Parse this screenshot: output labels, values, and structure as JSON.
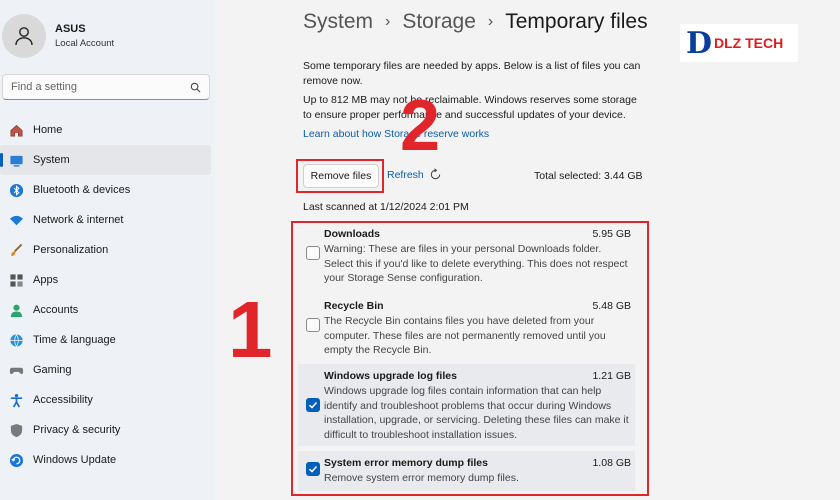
{
  "profile": {
    "name": "ASUS",
    "account": "Local Account"
  },
  "search": {
    "placeholder": "Find a setting"
  },
  "nav": [
    {
      "label": "Home",
      "icon": "home-icon"
    },
    {
      "label": "System",
      "icon": "monitor-icon",
      "active": true
    },
    {
      "label": "Bluetooth & devices",
      "icon": "bluetooth-icon"
    },
    {
      "label": "Network & internet",
      "icon": "wifi-icon"
    },
    {
      "label": "Personalization",
      "icon": "brush-icon"
    },
    {
      "label": "Apps",
      "icon": "apps-icon"
    },
    {
      "label": "Accounts",
      "icon": "person-icon"
    },
    {
      "label": "Time & language",
      "icon": "globe-icon"
    },
    {
      "label": "Gaming",
      "icon": "gamepad-icon"
    },
    {
      "label": "Accessibility",
      "icon": "accessibility-icon"
    },
    {
      "label": "Privacy & security",
      "icon": "shield-icon"
    },
    {
      "label": "Windows Update",
      "icon": "update-icon"
    }
  ],
  "breadcrumb": [
    "System",
    "Storage",
    "Temporary files"
  ],
  "logo": {
    "mark": "D",
    "text": "DLZ TECH"
  },
  "intro": {
    "p1": "Some temporary files are needed by apps. Below is a list of files you can remove now.",
    "p2": "Up to 812 MB may not be reclaimable. Windows reserves some storage to ensure proper performance and successful updates of your device.",
    "link": "Learn about how Storage reserve works"
  },
  "actions": {
    "remove": "Remove files",
    "refresh": "Refresh",
    "total": "Total selected: 3.44 GB"
  },
  "scanned": "Last scanned at 1/12/2024 2:01 PM",
  "annotations": {
    "one": "1",
    "two": "2"
  },
  "files": [
    {
      "name": "Downloads",
      "size": "5.95 GB",
      "checked": false,
      "desc": "Warning: These are files in your personal Downloads folder. Select this if you'd like to delete everything. This does not respect your Storage Sense configuration."
    },
    {
      "name": "Recycle Bin",
      "size": "5.48 GB",
      "checked": false,
      "desc": "The Recycle Bin contains files you have deleted from your computer. These files are not permanently removed until you empty the Recycle Bin."
    },
    {
      "name": "Windows upgrade log files",
      "size": "1.21 GB",
      "checked": true,
      "desc": "Windows upgrade log files contain information that can help identify and troubleshoot problems that occur during Windows installation, upgrade, or servicing.  Deleting these files can make it difficult to troubleshoot installation issues."
    },
    {
      "name": "System error memory dump files",
      "size": "1.08 GB",
      "checked": true,
      "desc": "Remove system error memory dump files."
    }
  ],
  "colors": {
    "accent": "#005fb8",
    "annotation": "#e0252b",
    "link": "#0b5cab"
  }
}
